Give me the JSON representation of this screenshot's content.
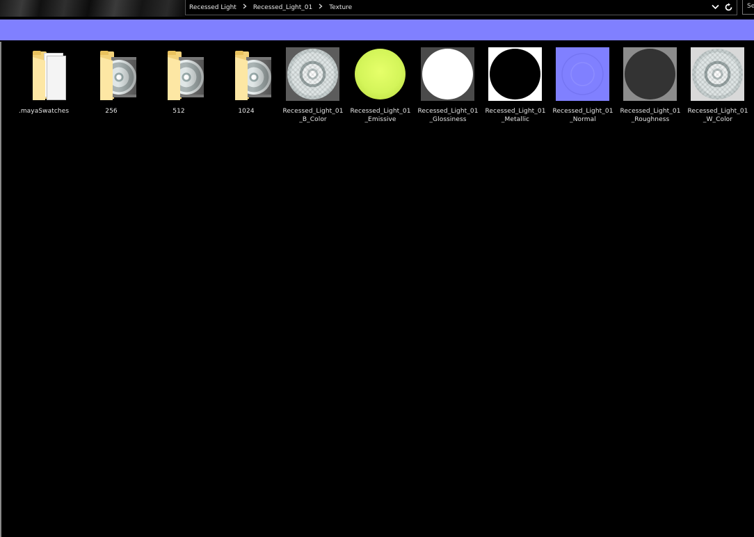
{
  "breadcrumb": {
    "items": [
      "Recessed Light",
      "Recessed_Light_01",
      "Texture"
    ]
  },
  "search": {
    "label": "Se"
  },
  "icons": {
    "separator": "chevron-right-icon",
    "dropdown": "chevron-down-icon",
    "refresh": "refresh-icon"
  },
  "colors": {
    "ribbon": "#8080ff",
    "emissive": "#d4f55a",
    "normal": "#8080ff",
    "roughness_bg": "#8c8c8c",
    "roughness_disc": "#333333"
  },
  "files": [
    {
      "name": ".mayaSwatches",
      "type": "folder"
    },
    {
      "name": "256",
      "type": "folder"
    },
    {
      "name": "512",
      "type": "folder"
    },
    {
      "name": "1024",
      "type": "folder"
    },
    {
      "name": "Recessed_Light_01\n_B_Color",
      "type": "texture"
    },
    {
      "name": "Recessed_Light_01\n_Emissive",
      "type": "texture"
    },
    {
      "name": "Recessed_Light_01\n_Glossiness",
      "type": "texture"
    },
    {
      "name": "Recessed_Light_01\n_Metallic",
      "type": "texture"
    },
    {
      "name": "Recessed_Light_01\n_Normal",
      "type": "texture"
    },
    {
      "name": "Recessed_Light_01\n_Roughness",
      "type": "texture"
    },
    {
      "name": "Recessed_Light_01\n_W_Color",
      "type": "texture"
    }
  ]
}
